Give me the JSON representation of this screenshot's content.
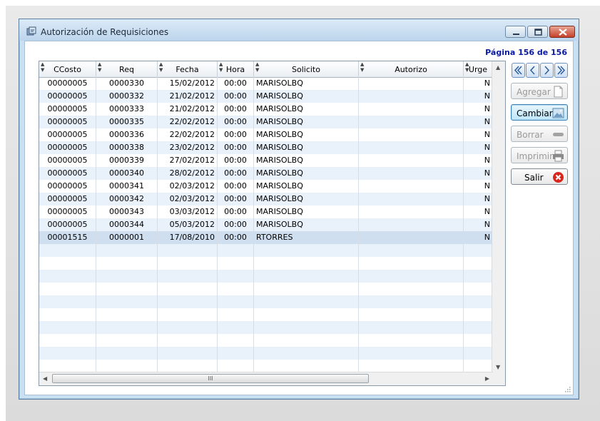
{
  "window": {
    "title": "Autorización de Requisiciones"
  },
  "pagination": {
    "label": "Página 156 de 156"
  },
  "grid": {
    "columns": [
      "CCosto",
      "Req",
      "Fecha",
      "Hora",
      "Solicito",
      "Autorizo",
      "Urge"
    ],
    "rows": [
      [
        "00000005",
        "0000330",
        "15/02/2012",
        "00:00",
        "MARISOLBQ",
        "",
        "N"
      ],
      [
        "00000005",
        "0000332",
        "21/02/2012",
        "00:00",
        "MARISOLBQ",
        "",
        "N"
      ],
      [
        "00000005",
        "0000333",
        "21/02/2012",
        "00:00",
        "MARISOLBQ",
        "",
        "N"
      ],
      [
        "00000005",
        "0000335",
        "22/02/2012",
        "00:00",
        "MARISOLBQ",
        "",
        "N"
      ],
      [
        "00000005",
        "0000336",
        "22/02/2012",
        "00:00",
        "MARISOLBQ",
        "",
        "N"
      ],
      [
        "00000005",
        "0000338",
        "23/02/2012",
        "00:00",
        "MARISOLBQ",
        "",
        "N"
      ],
      [
        "00000005",
        "0000339",
        "27/02/2012",
        "00:00",
        "MARISOLBQ",
        "",
        "N"
      ],
      [
        "00000005",
        "0000340",
        "28/02/2012",
        "00:00",
        "MARISOLBQ",
        "",
        "N"
      ],
      [
        "00000005",
        "0000341",
        "02/03/2012",
        "00:00",
        "MARISOLBQ",
        "",
        "N"
      ],
      [
        "00000005",
        "0000342",
        "02/03/2012",
        "00:00",
        "MARISOLBQ",
        "",
        "N"
      ],
      [
        "00000005",
        "0000343",
        "03/03/2012",
        "00:00",
        "MARISOLBQ",
        "",
        "N"
      ],
      [
        "00000005",
        "0000344",
        "05/03/2012",
        "00:00",
        "MARISOLBQ",
        "",
        "N"
      ],
      [
        "00001515",
        "0000001",
        "17/08/2010",
        "00:00",
        "RTORRES",
        "",
        "N"
      ]
    ],
    "selected_row": 12,
    "hscroll_thumb_label": "III"
  },
  "buttons": {
    "agregar": "Agregar",
    "cambiar": "Cambiar",
    "borrar": "Borrar",
    "imprimir": "Imprimir",
    "salir": "Salir"
  },
  "nav": {
    "first": "first-page-icon",
    "prev": "prev-page-icon",
    "next": "next-page-icon",
    "last": "last-page-icon"
  }
}
